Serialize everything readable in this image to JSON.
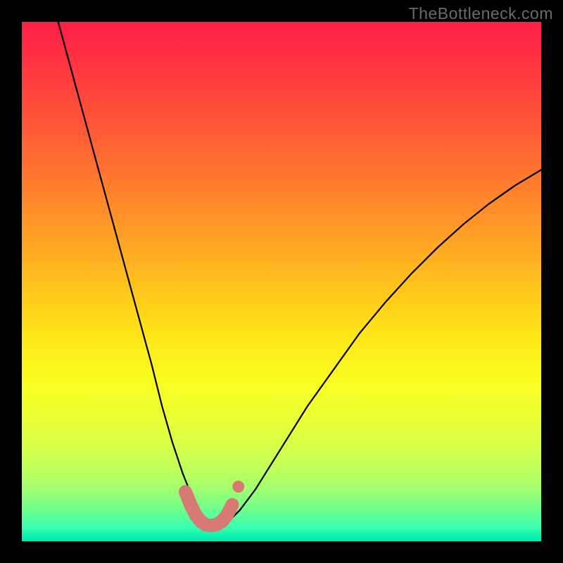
{
  "watermark": "TheBottleneck.com",
  "chart_data": {
    "type": "line",
    "title": "",
    "xlabel": "",
    "ylabel": "",
    "xlim": [
      0,
      100
    ],
    "ylim": [
      0,
      100
    ],
    "grid": false,
    "series": [
      {
        "name": "bottleneck-curve",
        "x": [
          7,
          10,
          13,
          16,
          19,
          22,
          25,
          27,
          29,
          31,
          33,
          34.5,
          36,
          37,
          38,
          40,
          42,
          45,
          50,
          55,
          60,
          65,
          70,
          75,
          80,
          85,
          90,
          95,
          100
        ],
        "y": [
          100,
          89,
          78,
          67,
          56,
          45,
          34,
          26,
          19,
          13,
          8,
          5,
          3.4,
          3,
          3.2,
          4,
          6,
          10,
          18,
          26,
          33,
          40,
          46,
          51.5,
          56.5,
          61,
          65,
          68.5,
          71.5
        ],
        "color": "#000000"
      },
      {
        "name": "trough-marker",
        "x": [
          31.5,
          32.5,
          33.5,
          34.5,
          35.5,
          36.5,
          37.5,
          38.5,
          39.5,
          40.5
        ],
        "y": [
          9.5,
          7,
          5,
          3.8,
          3.1,
          3.0,
          3.2,
          3.8,
          5,
          7
        ],
        "color": "#d87a74"
      },
      {
        "name": "detached-marker",
        "x": [
          41.7
        ],
        "y": [
          10.5
        ],
        "color": "#d87a74"
      }
    ]
  }
}
